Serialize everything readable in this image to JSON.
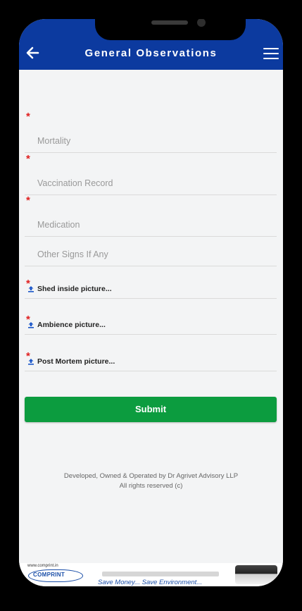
{
  "header": {
    "title": "General Observations",
    "back_icon": "arrow-left-icon",
    "menu_icon": "hamburger-menu-icon",
    "color": "#0c3a9f"
  },
  "form": {
    "required_marker": "*",
    "fields": [
      {
        "placeholder": "Mortality",
        "required": true
      },
      {
        "placeholder": "Vaccination Record",
        "required": true
      },
      {
        "placeholder": "Medication",
        "required": true
      },
      {
        "placeholder": "Other Signs If Any",
        "required": false
      }
    ],
    "uploads": [
      {
        "label": "Shed inside picture...",
        "required": true,
        "icon": "upload-icon"
      },
      {
        "label": "Ambience picture...",
        "required": true,
        "icon": "upload-icon"
      },
      {
        "label": "Post Mortem picture...",
        "required": true,
        "icon": "upload-icon"
      }
    ],
    "submit_label": "Submit",
    "submit_color": "#0c9c3f"
  },
  "footer": {
    "line1": "Developed, Owned & Operated by Dr Agrivet Advisory LLP",
    "line2": "All rights reserved (c)"
  },
  "ad": {
    "url": "www.comprint.in",
    "brand": "COMPRINT",
    "tagline": "Save Money... Save Environment..."
  }
}
